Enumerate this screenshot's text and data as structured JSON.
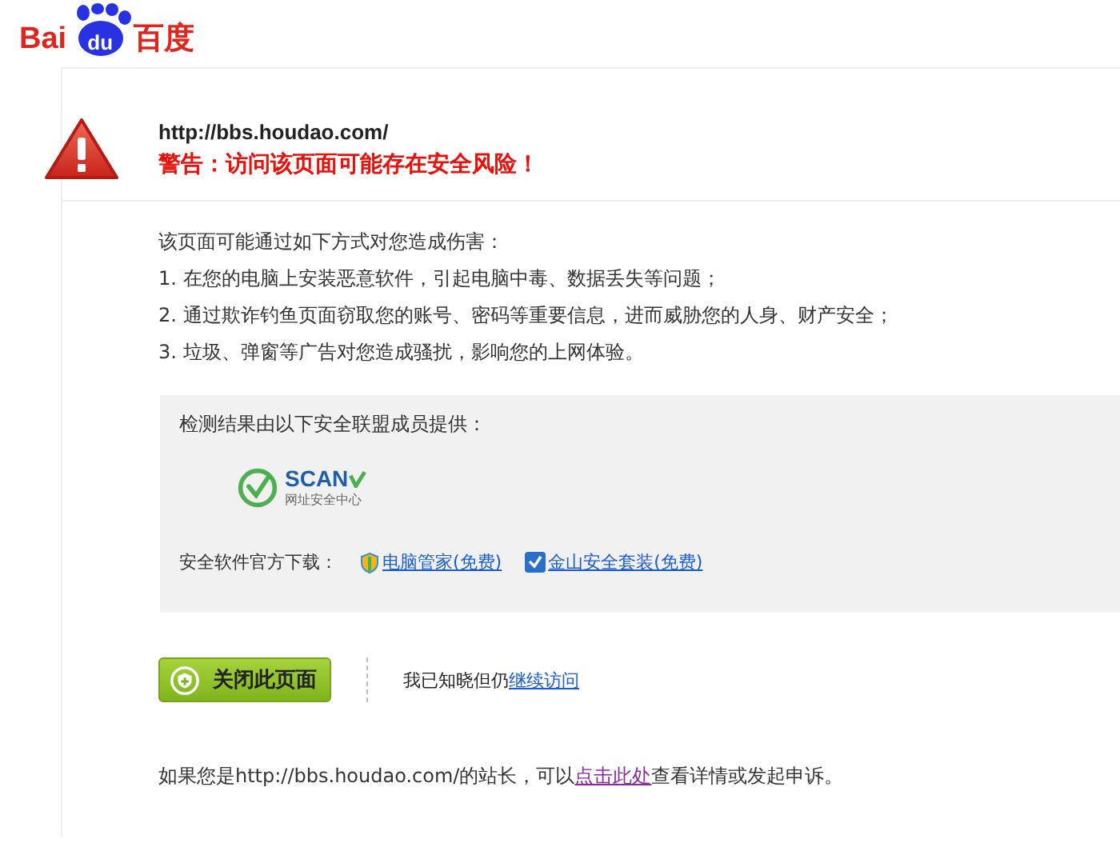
{
  "logo": {
    "left": "Bai",
    "paw": "du",
    "right": "百度"
  },
  "header": {
    "url": "http://bbs.houdao.com/",
    "warning": "警告：访问该页面可能存在安全风险！"
  },
  "harm": {
    "intro": "该页面可能通过如下方式对您造成伤害：",
    "items": [
      "1. 在您的电脑上安装恶意软件，引起电脑中毒、数据丢失等问题；",
      "2. 通过欺诈钓鱼页面窃取您的账号、密码等重要信息，进而威胁您的人身、财产安全；",
      "3. 垃圾、弹窗等广告对您造成骚扰，影响您的上网体验。"
    ]
  },
  "provider": {
    "title": "检测结果由以下安全联盟成员提供：",
    "brand": "SCAN",
    "brand_sub": "网址安全中心",
    "download_label": "安全软件官方下载：",
    "downloads": [
      {
        "label": "电脑管家(免费)",
        "kind": "shield"
      },
      {
        "label": "金山安全套装(免费)",
        "kind": "check"
      }
    ]
  },
  "actions": {
    "close_button": "关闭此页面",
    "continue_prefix": "我已知晓但仍",
    "continue_link": "继续访问"
  },
  "footer": {
    "before": "如果您是http://bbs.houdao.com/的站长，可以",
    "link": "点击此处",
    "after": "查看详情或发起申诉。"
  }
}
